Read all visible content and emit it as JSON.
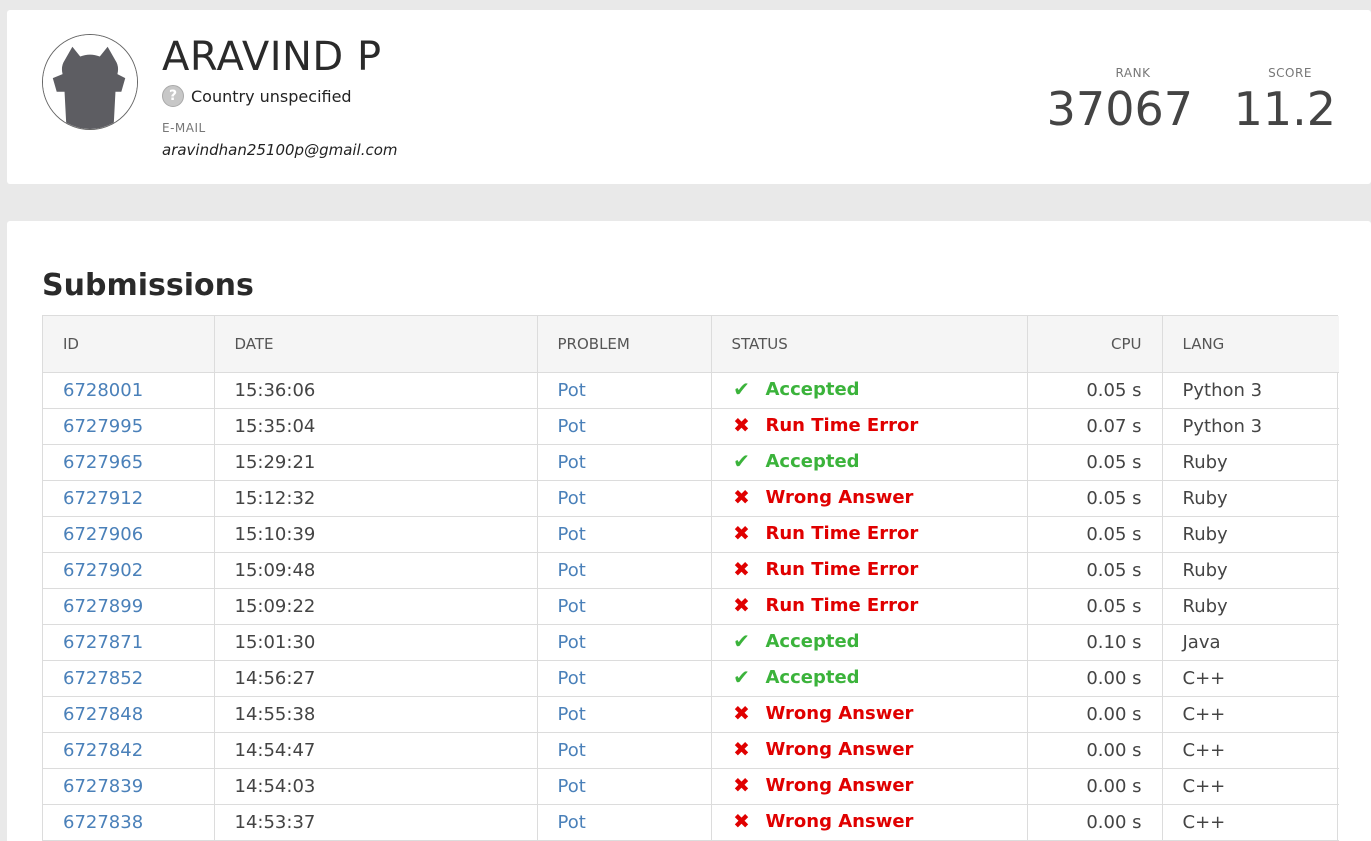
{
  "profile": {
    "name": "ARAVIND P",
    "country": "Country unspecified",
    "email_label": "E-MAIL",
    "email": "aravindhan25100p@gmail.com",
    "rank_label": "RANK",
    "rank": "37067",
    "score_label": "SCORE",
    "score": "11.2"
  },
  "submissions": {
    "title": "Submissions",
    "columns": {
      "id": "ID",
      "date": "DATE",
      "problem": "PROBLEM",
      "status": "STATUS",
      "cpu": "CPU",
      "lang": "LANG"
    },
    "rows": [
      {
        "id": "6728001",
        "date": "15:36:06",
        "problem": "Pot",
        "status": "Accepted",
        "cpu": "0.05 s",
        "lang": "Python 3"
      },
      {
        "id": "6727995",
        "date": "15:35:04",
        "problem": "Pot",
        "status": "Run Time Error",
        "cpu": "0.07 s",
        "lang": "Python 3"
      },
      {
        "id": "6727965",
        "date": "15:29:21",
        "problem": "Pot",
        "status": "Accepted",
        "cpu": "0.05 s",
        "lang": "Ruby"
      },
      {
        "id": "6727912",
        "date": "15:12:32",
        "problem": "Pot",
        "status": "Wrong Answer",
        "cpu": "0.05 s",
        "lang": "Ruby"
      },
      {
        "id": "6727906",
        "date": "15:10:39",
        "problem": "Pot",
        "status": "Run Time Error",
        "cpu": "0.05 s",
        "lang": "Ruby"
      },
      {
        "id": "6727902",
        "date": "15:09:48",
        "problem": "Pot",
        "status": "Run Time Error",
        "cpu": "0.05 s",
        "lang": "Ruby"
      },
      {
        "id": "6727899",
        "date": "15:09:22",
        "problem": "Pot",
        "status": "Run Time Error",
        "cpu": "0.05 s",
        "lang": "Ruby"
      },
      {
        "id": "6727871",
        "date": "15:01:30",
        "problem": "Pot",
        "status": "Accepted",
        "cpu": "0.10 s",
        "lang": "Java"
      },
      {
        "id": "6727852",
        "date": "14:56:27",
        "problem": "Pot",
        "status": "Accepted",
        "cpu": "0.00 s",
        "lang": "C++"
      },
      {
        "id": "6727848",
        "date": "14:55:38",
        "problem": "Pot",
        "status": "Wrong Answer",
        "cpu": "0.00 s",
        "lang": "C++"
      },
      {
        "id": "6727842",
        "date": "14:54:47",
        "problem": "Pot",
        "status": "Wrong Answer",
        "cpu": "0.00 s",
        "lang": "C++"
      },
      {
        "id": "6727839",
        "date": "14:54:03",
        "problem": "Pot",
        "status": "Wrong Answer",
        "cpu": "0.00 s",
        "lang": "C++"
      },
      {
        "id": "6727838",
        "date": "14:53:37",
        "problem": "Pot",
        "status": "Wrong Answer",
        "cpu": "0.00 s",
        "lang": "C++"
      }
    ]
  },
  "colors": {
    "accepted": "#3bb33b",
    "error": "#e00000",
    "link": "#4a80b9"
  },
  "icons": {
    "accepted": "check-icon",
    "error": "cross-icon",
    "country": "question-icon"
  }
}
